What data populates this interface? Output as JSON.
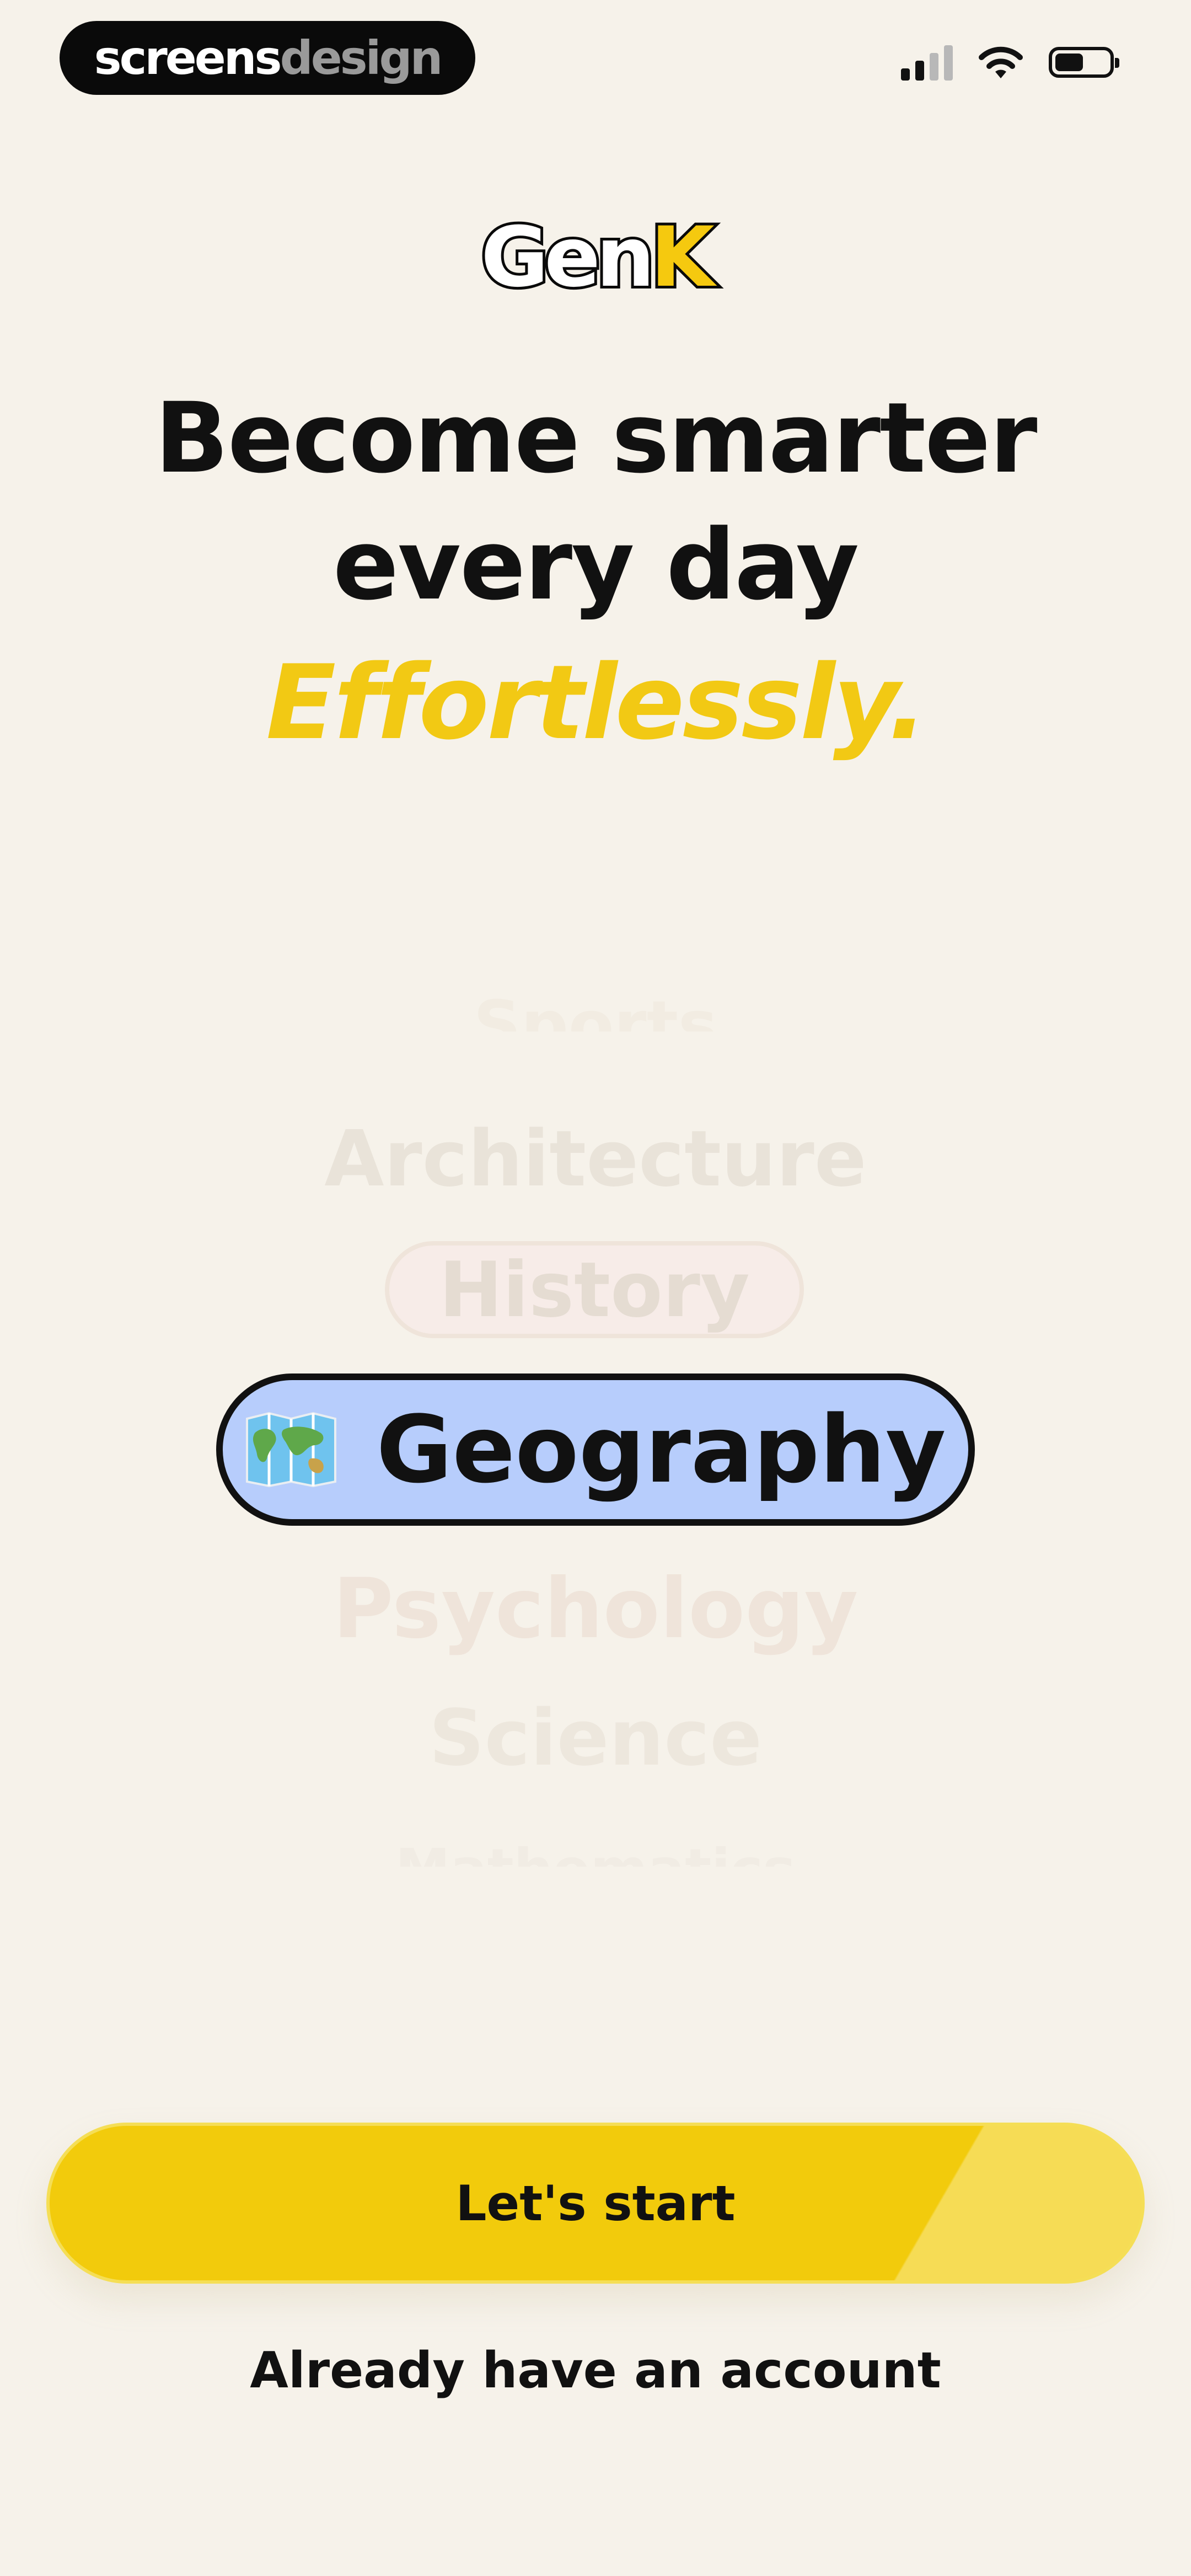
{
  "watermark": {
    "part1": "screens",
    "part2": "design"
  },
  "brand": {
    "logo_left": "Gen",
    "logo_right": "K"
  },
  "hero": {
    "headline_line1": "Become smarter",
    "headline_line2": "every day",
    "tagline": "Effortlessly."
  },
  "topics": {
    "items": [
      "Sports",
      "Architecture",
      "History",
      "Geography",
      "Psychology",
      "Science",
      "Mathematics"
    ],
    "selected": "Geography",
    "selected_icon": "world-map-icon"
  },
  "actions": {
    "start_label": "Let's start",
    "login_label": "Already have an account"
  },
  "colors": {
    "background": "#f6f2ea",
    "accent_yellow": "#f2cb0c",
    "selected_pill": "#b7cdfc",
    "text_dark": "#111111"
  }
}
